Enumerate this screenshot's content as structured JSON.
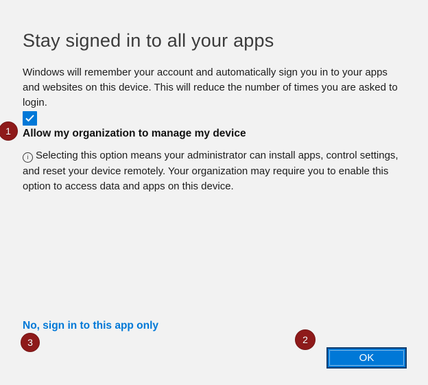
{
  "dialog": {
    "title": "Stay signed in to all your apps",
    "description": "Windows will remember your account and automatically sign you in to your apps and websites on this device. This will reduce the number of times you are asked to login.",
    "checkbox": {
      "label": "Allow my organization to manage my device",
      "checked": true
    },
    "info_note": "Selecting this option means your administrator can install apps, control settings, and reset your device remotely. Your organization may require you to enable this option to access data and apps on this device.",
    "link_label": "No, sign in to this app only",
    "ok_label": "OK"
  },
  "annotations": {
    "marker1": "1",
    "marker2": "2",
    "marker3": "3"
  },
  "colors": {
    "background": "#f2f2f2",
    "accent_blue": "#0078d7",
    "annotation_red": "#8e1a1a",
    "title_gray": "#3b3b3b",
    "body_text": "#1c1c1c",
    "ok_border": "#0b3c6e"
  }
}
